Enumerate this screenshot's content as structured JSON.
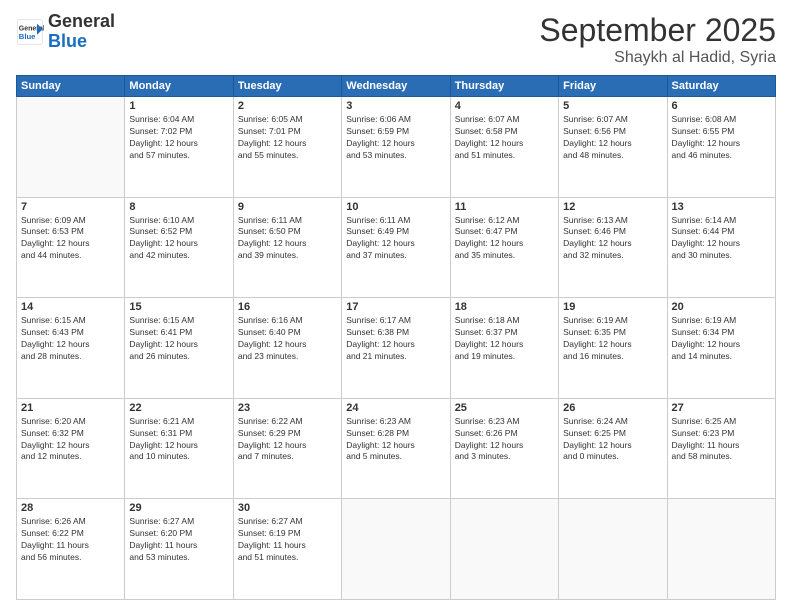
{
  "logo": {
    "general": "General",
    "blue": "Blue"
  },
  "title": "September 2025",
  "subtitle": "Shaykh al Hadid, Syria",
  "header_days": [
    "Sunday",
    "Monday",
    "Tuesday",
    "Wednesday",
    "Thursday",
    "Friday",
    "Saturday"
  ],
  "weeks": [
    [
      {
        "day": "",
        "info": ""
      },
      {
        "day": "1",
        "info": "Sunrise: 6:04 AM\nSunset: 7:02 PM\nDaylight: 12 hours\nand 57 minutes."
      },
      {
        "day": "2",
        "info": "Sunrise: 6:05 AM\nSunset: 7:01 PM\nDaylight: 12 hours\nand 55 minutes."
      },
      {
        "day": "3",
        "info": "Sunrise: 6:06 AM\nSunset: 6:59 PM\nDaylight: 12 hours\nand 53 minutes."
      },
      {
        "day": "4",
        "info": "Sunrise: 6:07 AM\nSunset: 6:58 PM\nDaylight: 12 hours\nand 51 minutes."
      },
      {
        "day": "5",
        "info": "Sunrise: 6:07 AM\nSunset: 6:56 PM\nDaylight: 12 hours\nand 48 minutes."
      },
      {
        "day": "6",
        "info": "Sunrise: 6:08 AM\nSunset: 6:55 PM\nDaylight: 12 hours\nand 46 minutes."
      }
    ],
    [
      {
        "day": "7",
        "info": "Sunrise: 6:09 AM\nSunset: 6:53 PM\nDaylight: 12 hours\nand 44 minutes."
      },
      {
        "day": "8",
        "info": "Sunrise: 6:10 AM\nSunset: 6:52 PM\nDaylight: 12 hours\nand 42 minutes."
      },
      {
        "day": "9",
        "info": "Sunrise: 6:11 AM\nSunset: 6:50 PM\nDaylight: 12 hours\nand 39 minutes."
      },
      {
        "day": "10",
        "info": "Sunrise: 6:11 AM\nSunset: 6:49 PM\nDaylight: 12 hours\nand 37 minutes."
      },
      {
        "day": "11",
        "info": "Sunrise: 6:12 AM\nSunset: 6:47 PM\nDaylight: 12 hours\nand 35 minutes."
      },
      {
        "day": "12",
        "info": "Sunrise: 6:13 AM\nSunset: 6:46 PM\nDaylight: 12 hours\nand 32 minutes."
      },
      {
        "day": "13",
        "info": "Sunrise: 6:14 AM\nSunset: 6:44 PM\nDaylight: 12 hours\nand 30 minutes."
      }
    ],
    [
      {
        "day": "14",
        "info": "Sunrise: 6:15 AM\nSunset: 6:43 PM\nDaylight: 12 hours\nand 28 minutes."
      },
      {
        "day": "15",
        "info": "Sunrise: 6:15 AM\nSunset: 6:41 PM\nDaylight: 12 hours\nand 26 minutes."
      },
      {
        "day": "16",
        "info": "Sunrise: 6:16 AM\nSunset: 6:40 PM\nDaylight: 12 hours\nand 23 minutes."
      },
      {
        "day": "17",
        "info": "Sunrise: 6:17 AM\nSunset: 6:38 PM\nDaylight: 12 hours\nand 21 minutes."
      },
      {
        "day": "18",
        "info": "Sunrise: 6:18 AM\nSunset: 6:37 PM\nDaylight: 12 hours\nand 19 minutes."
      },
      {
        "day": "19",
        "info": "Sunrise: 6:19 AM\nSunset: 6:35 PM\nDaylight: 12 hours\nand 16 minutes."
      },
      {
        "day": "20",
        "info": "Sunrise: 6:19 AM\nSunset: 6:34 PM\nDaylight: 12 hours\nand 14 minutes."
      }
    ],
    [
      {
        "day": "21",
        "info": "Sunrise: 6:20 AM\nSunset: 6:32 PM\nDaylight: 12 hours\nand 12 minutes."
      },
      {
        "day": "22",
        "info": "Sunrise: 6:21 AM\nSunset: 6:31 PM\nDaylight: 12 hours\nand 10 minutes."
      },
      {
        "day": "23",
        "info": "Sunrise: 6:22 AM\nSunset: 6:29 PM\nDaylight: 12 hours\nand 7 minutes."
      },
      {
        "day": "24",
        "info": "Sunrise: 6:23 AM\nSunset: 6:28 PM\nDaylight: 12 hours\nand 5 minutes."
      },
      {
        "day": "25",
        "info": "Sunrise: 6:23 AM\nSunset: 6:26 PM\nDaylight: 12 hours\nand 3 minutes."
      },
      {
        "day": "26",
        "info": "Sunrise: 6:24 AM\nSunset: 6:25 PM\nDaylight: 12 hours\nand 0 minutes."
      },
      {
        "day": "27",
        "info": "Sunrise: 6:25 AM\nSunset: 6:23 PM\nDaylight: 11 hours\nand 58 minutes."
      }
    ],
    [
      {
        "day": "28",
        "info": "Sunrise: 6:26 AM\nSunset: 6:22 PM\nDaylight: 11 hours\nand 56 minutes."
      },
      {
        "day": "29",
        "info": "Sunrise: 6:27 AM\nSunset: 6:20 PM\nDaylight: 11 hours\nand 53 minutes."
      },
      {
        "day": "30",
        "info": "Sunrise: 6:27 AM\nSunset: 6:19 PM\nDaylight: 11 hours\nand 51 minutes."
      },
      {
        "day": "",
        "info": ""
      },
      {
        "day": "",
        "info": ""
      },
      {
        "day": "",
        "info": ""
      },
      {
        "day": "",
        "info": ""
      }
    ]
  ]
}
